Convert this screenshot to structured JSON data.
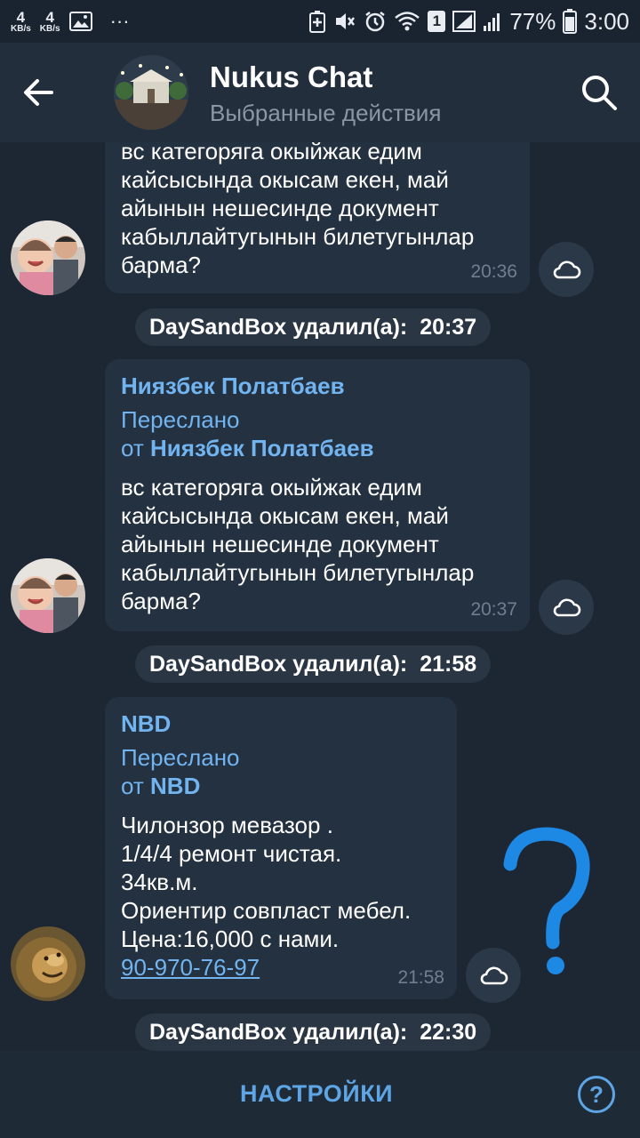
{
  "status_bar": {
    "speed1_value": "4",
    "speed1_unit": "KB/s",
    "speed2_value": "4",
    "speed2_unit": "KB/s",
    "dots": "···",
    "sim": "1",
    "battery": "77%",
    "time": "3:00"
  },
  "header": {
    "title": "Nukus Chat",
    "subtitle": "Выбранные действия"
  },
  "messages": [
    {
      "text": "вс категоряга окыйжак едим\nкайсысында окысам екен, май\nайынын нешесинде документ\nкабыллайтугынын билетугынлар\nбарма?",
      "time": "20:36"
    },
    {
      "name": "Ниязбек Полатбаев",
      "forwarded_label": "Переслано",
      "forwarded_from_prefix": "от",
      "forwarded_from": "Ниязбек Полатбаев",
      "text": "вс категоряга окыйжак едим\nкайсысында окысам екен, май\nайынын нешесинде документ\nкабыллайтугынын билетугынлар\nбарма?",
      "time": "20:37"
    },
    {
      "name": "NBD",
      "forwarded_label": "Переслано",
      "forwarded_from_prefix": "от",
      "forwarded_from": "NBD",
      "text": "Чилонзор мевазор .\n1/4/4 ремонт чистая.\n34кв.м.\nОриентир совпласт мебел.\nЦена:16,000 с нами.",
      "phone": "90-970-76-97",
      "time": "21:58"
    }
  ],
  "service_messages": [
    {
      "text": "DaySandBox удалил(а):",
      "time": "20:37"
    },
    {
      "text": "DaySandBox удалил(а):",
      "time": "21:58"
    },
    {
      "text": "DaySandBox удалил(а):",
      "time": "22:30"
    }
  ],
  "bottom": {
    "settings_label": "НАСТРОЙКИ",
    "help_label": "?"
  },
  "colors": {
    "background": "#1d2733",
    "header": "#232e3c",
    "bubble": "#243140",
    "accent": "#71b4f0",
    "annotation_question_mark": "#1e88e5"
  }
}
